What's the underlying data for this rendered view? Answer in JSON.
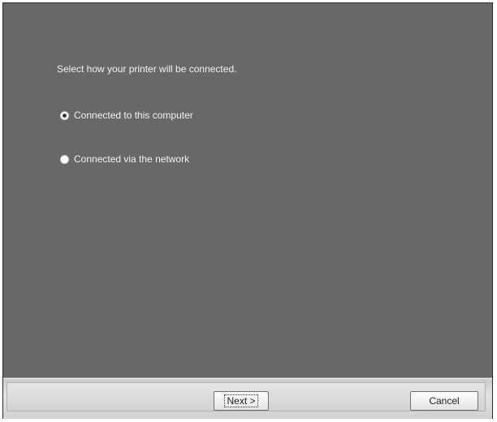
{
  "dialog": {
    "prompt": "Select how your printer will be connected.",
    "options": [
      {
        "label": "Connected to this computer",
        "selected": true
      },
      {
        "label": "Connected via the network",
        "selected": false
      }
    ]
  },
  "footer": {
    "next_label": "Next >",
    "cancel_label": "Cancel"
  }
}
